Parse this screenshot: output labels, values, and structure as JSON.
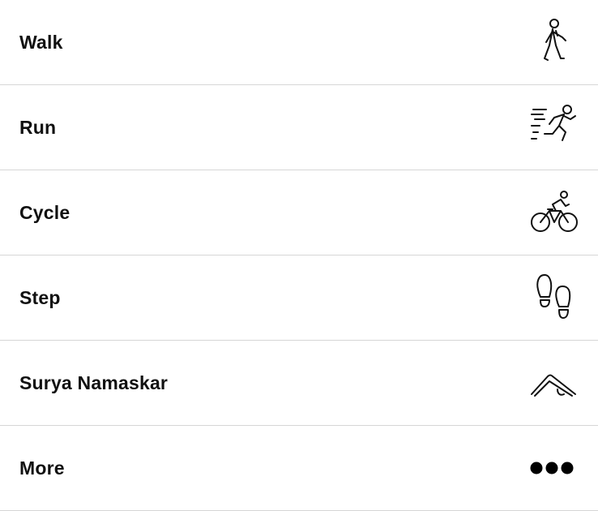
{
  "activities": [
    {
      "label": "Walk",
      "icon": "walk-icon"
    },
    {
      "label": "Run",
      "icon": "run-icon"
    },
    {
      "label": "Cycle",
      "icon": "cycle-icon"
    },
    {
      "label": "Step",
      "icon": "footsteps-icon"
    },
    {
      "label": "Surya Namaskar",
      "icon": "yoga-pose-icon"
    },
    {
      "label": "More",
      "icon": "more-dots-icon"
    }
  ]
}
